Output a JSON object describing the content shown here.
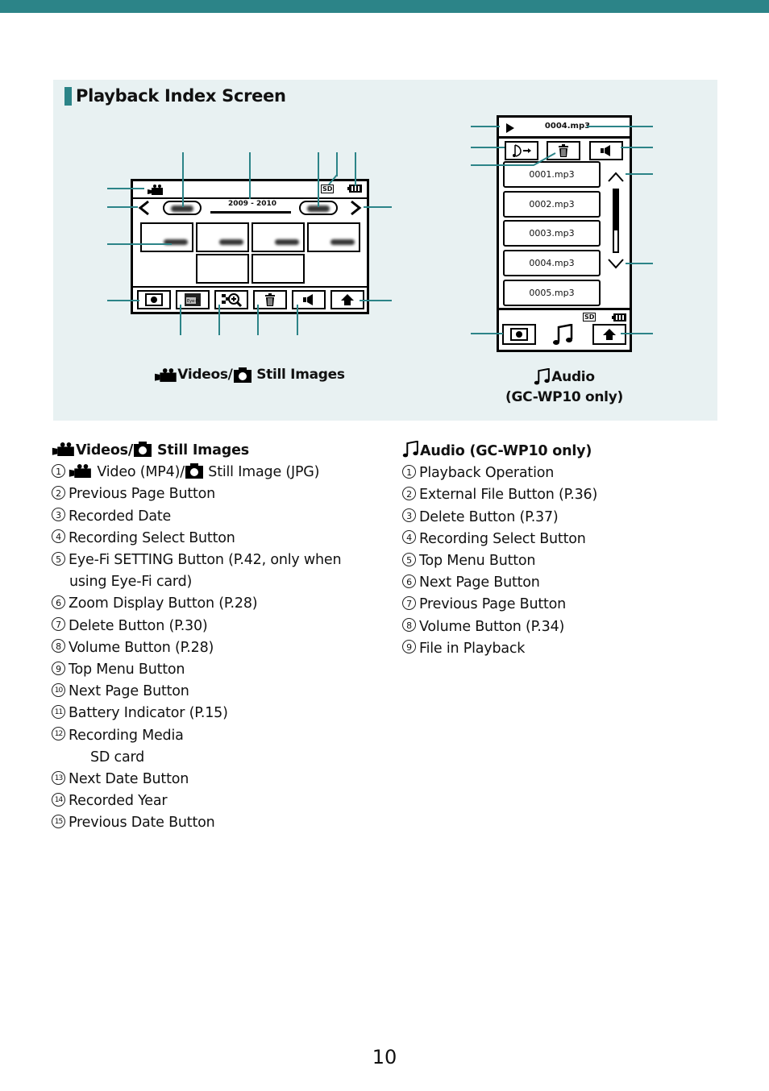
{
  "header_bar_color": "#2c8488",
  "section": {
    "title": "Playback Index Screen",
    "accent_color": "#2c8488",
    "background": "#e8f1f2"
  },
  "video_screen": {
    "caption_videos": "Videos/",
    "caption_still": "Still Images",
    "date_range": "2009 - 2010",
    "media_badge": "SD",
    "mode_icon": "video-camera-icon",
    "buttons": [
      {
        "name": "record-button",
        "icon": "record-dot-icon"
      },
      {
        "name": "eye-fi-button",
        "icon": "eye-fi-icon",
        "label": "Eye-Fi"
      },
      {
        "name": "zoom-display-button",
        "icon": "zoom-display-icon"
      },
      {
        "name": "delete-button",
        "icon": "trash-icon"
      },
      {
        "name": "volume-button",
        "icon": "speaker-icon"
      },
      {
        "name": "top-menu-button",
        "icon": "home-icon"
      }
    ]
  },
  "audio_screen": {
    "caption_line1": "Audio",
    "caption_line2": "(GC-WP10 only)",
    "now_playing": "0004.mp3",
    "media_badge": "SD",
    "files": [
      "0001.mp3",
      "0002.mp3",
      "0003.mp3",
      "0004.mp3",
      "0005.mp3"
    ]
  },
  "video_legend": {
    "heading_videos": "Videos/",
    "heading_still": "Still Images",
    "items": [
      {
        "num": "1",
        "text_a": "Video (MP4)/",
        "text_b": "Still Image (JPG)"
      },
      {
        "num": "2",
        "text": "Previous Page Button"
      },
      {
        "num": "3",
        "text": "Recorded Date"
      },
      {
        "num": "4",
        "text": "Recording Select Button"
      },
      {
        "num": "5",
        "text": "Eye-Fi SETTING Button (P.42, only when",
        "cont": "using Eye-Fi card)"
      },
      {
        "num": "6",
        "text": "Zoom Display Button (P.28)"
      },
      {
        "num": "7",
        "text": "Delete Button (P.30)"
      },
      {
        "num": "8",
        "text": "Volume Button (P.28)"
      },
      {
        "num": "9",
        "text": "Top Menu Button"
      },
      {
        "num": "10",
        "text": "Next Page Button"
      },
      {
        "num": "11",
        "text": "Battery Indicator (P.15)"
      },
      {
        "num": "12",
        "text": "Recording Media",
        "cont": "SD card"
      },
      {
        "num": "13",
        "text": "Next Date Button"
      },
      {
        "num": "14",
        "text": "Recorded Year"
      },
      {
        "num": "15",
        "text": "Previous Date Button"
      }
    ]
  },
  "audio_legend": {
    "heading": "Audio (GC-WP10 only)",
    "items": [
      {
        "num": "1",
        "text": "Playback Operation"
      },
      {
        "num": "2",
        "text": "External File Button (P.36)"
      },
      {
        "num": "3",
        "text": "Delete Button (P.37)"
      },
      {
        "num": "4",
        "text": "Recording Select Button"
      },
      {
        "num": "5",
        "text": "Top Menu Button"
      },
      {
        "num": "6",
        "text": "Next Page Button"
      },
      {
        "num": "7",
        "text": "Previous Page Button"
      },
      {
        "num": "8",
        "text": "Volume Button (P.34)"
      },
      {
        "num": "9",
        "text": "File in Playback"
      }
    ]
  },
  "page_number": "10"
}
